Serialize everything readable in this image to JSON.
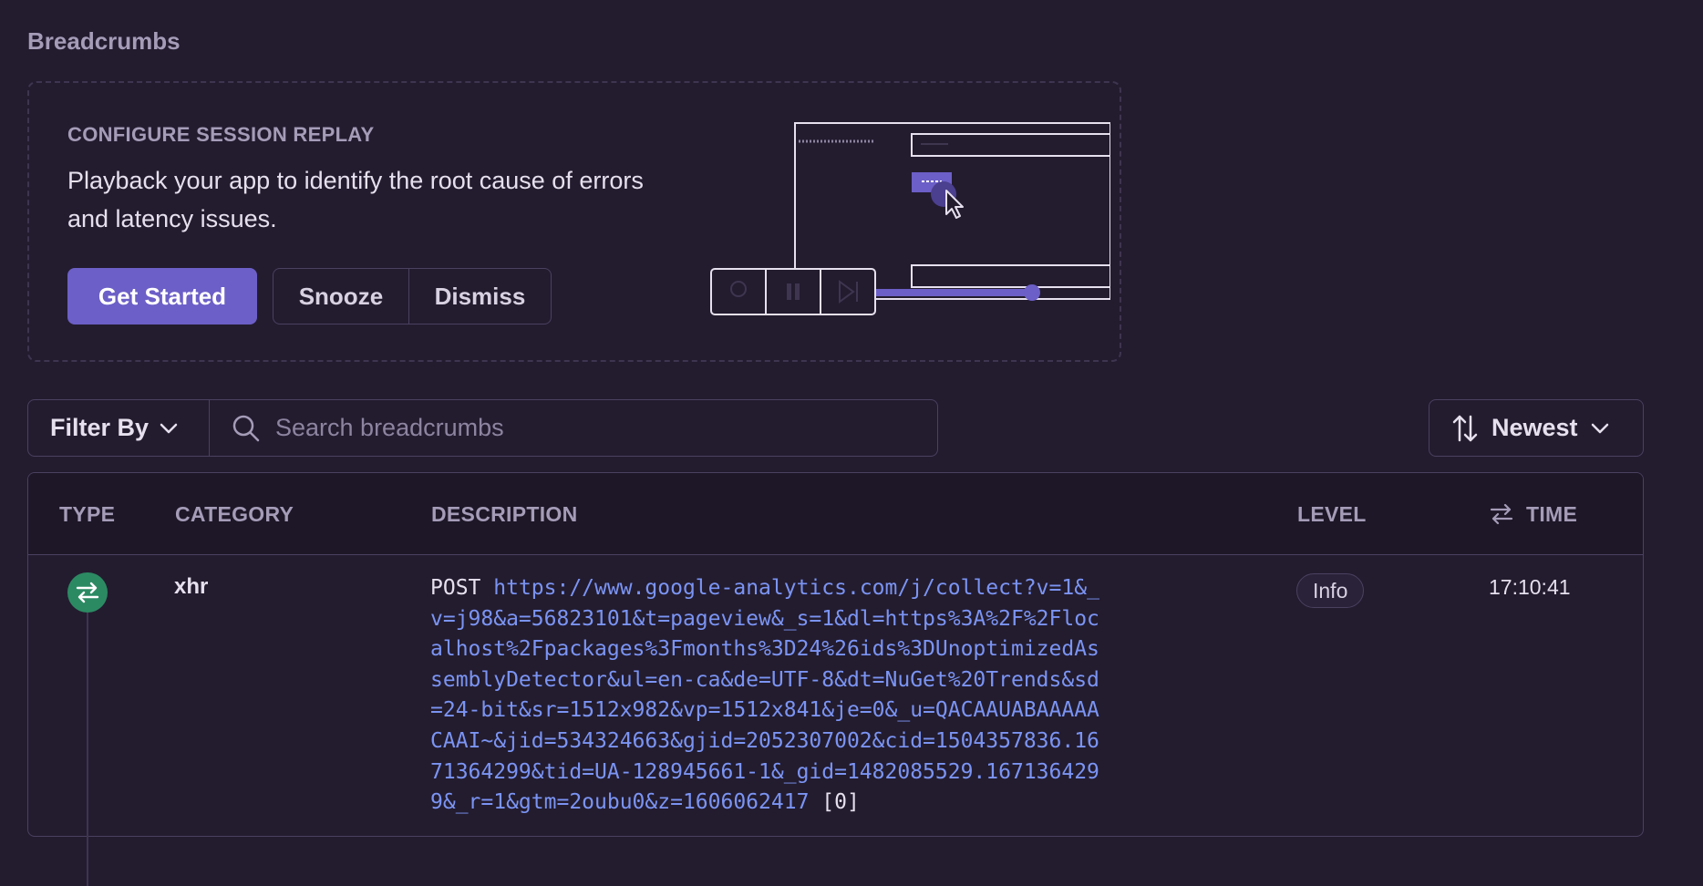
{
  "section_title": "Breadcrumbs",
  "promo": {
    "eyebrow": "CONFIGURE SESSION REPLAY",
    "body": "Playback your app to identify the root cause of errors and latency issues.",
    "get_started": "Get Started",
    "snooze": "Snooze",
    "dismiss": "Dismiss"
  },
  "filter": {
    "label": "Filter By",
    "search_placeholder": "Search breadcrumbs",
    "search_value": ""
  },
  "sort": {
    "label": "Newest"
  },
  "table": {
    "columns": {
      "type": "TYPE",
      "category": "CATEGORY",
      "description": "DESCRIPTION",
      "level": "LEVEL",
      "time": "TIME"
    },
    "rows": [
      {
        "type_icon": "arrows-exchange-icon",
        "category": "xhr",
        "method": "POST",
        "url": "https://www.google-analytics.com/j/collect?v=1&_v=j98&a=56823101&t=pageview&_s=1&dl=https%3A%2F%2Flocalhost%2Fpackages%3Fmonths%3D24%26ids%3DUnoptimizedAssemblyDetector&ul=en-ca&de=UTF-8&dt=NuGet%20Trends&sd=24-bit&sr=1512x982&vp=1512x841&je=0&_u=QACAAUABAAAAACAAI~&jid=534324663&gjid=2052307002&cid=1504357836.1671364299&tid=UA-128945661-1&_gid=1482085529.1671364299&_r=1&gtm=2oubu0&z=1606062417",
        "status": "[0]",
        "level": "Info",
        "time": "17:10:41"
      }
    ]
  },
  "colors": {
    "background": "#231c2f",
    "accent": "#6c5fc7",
    "link": "#7b94f3",
    "xhr_icon": "#2c8a63"
  }
}
